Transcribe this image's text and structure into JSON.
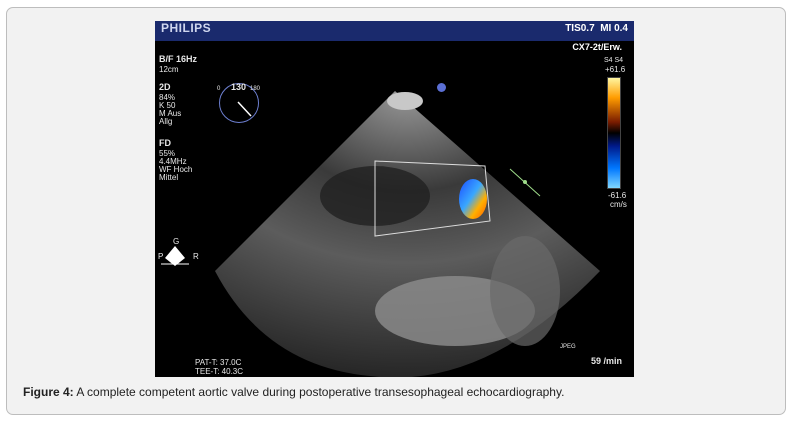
{
  "echo": {
    "vendor": "PHILIPS",
    "tis_mi": "TIS0.7  MI 0.4",
    "probe": "CX7-2t/Erw.",
    "left_params": [
      "B/F 16Hz",
      "12cm"
    ],
    "mode_2d": [
      "2D",
      "84%",
      "K 50",
      "M Aus",
      "Allg"
    ],
    "mode_fd": [
      "FD",
      "55%",
      "4.4MHz",
      "WF Hoch",
      "Mittel"
    ],
    "angle": "130",
    "angle_left": "0",
    "angle_right": "180",
    "scale_top_label": "S4 S4",
    "scale_max": "+61.6",
    "scale_min": "-61.6",
    "scale_unit": "cm/s",
    "orientation": {
      "top": "G",
      "left": "P",
      "right": "R"
    },
    "temps": [
      "PAT-T: 37.0C",
      "TEE-T: 40.3C"
    ],
    "jpeg_label": "JPEG",
    "heart_rate": "59 /min"
  },
  "caption": {
    "label": "Figure 4:",
    "text": " A complete competent aortic valve during postoperative transesophageal echocardiography."
  }
}
